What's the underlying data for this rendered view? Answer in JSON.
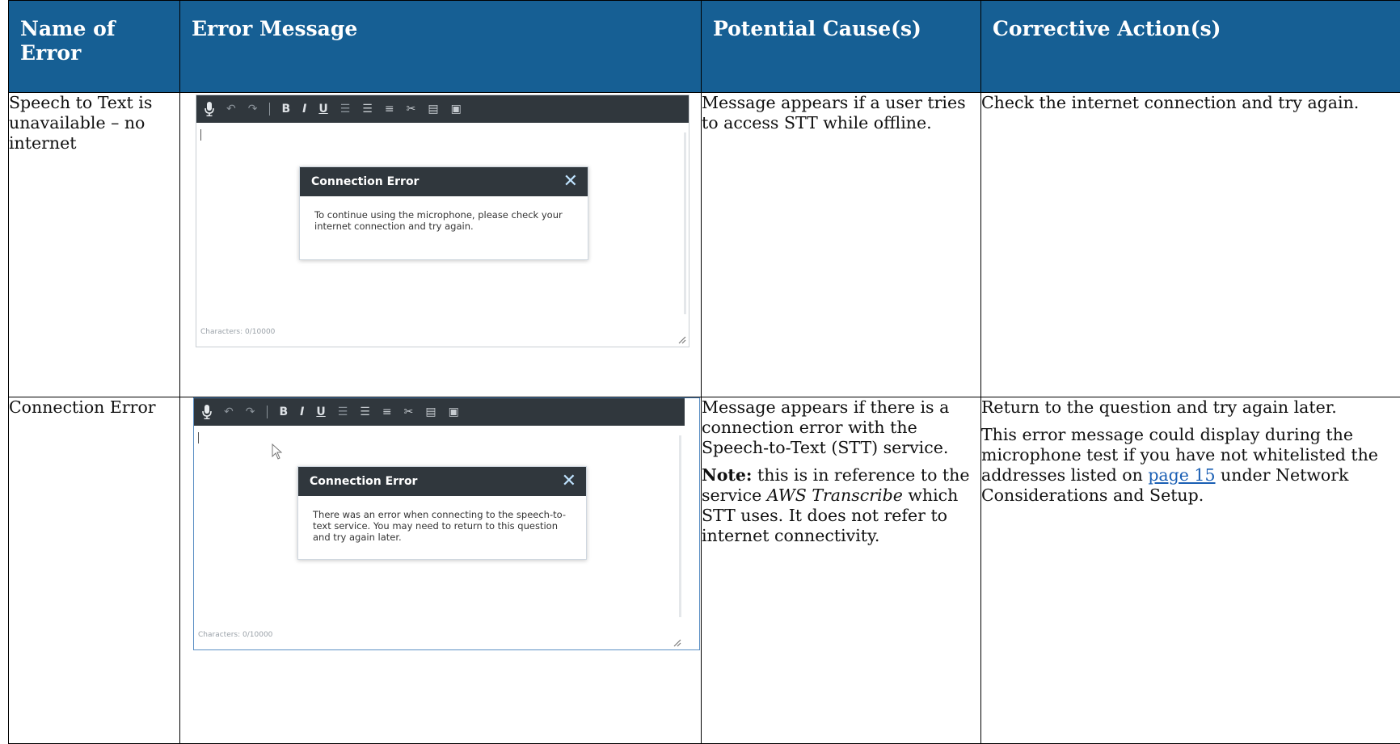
{
  "table": {
    "headers": [
      "Name of Error",
      "Error Message",
      "Potential Cause(s)",
      "Corrective Action(s)"
    ],
    "rows": [
      {
        "name": "Speech to Text is unavailable – no internet",
        "shot": {
          "dialog_title": "Connection Error",
          "dialog_body": "To continue using the microphone, please check your internet connection and try again.",
          "char_count": "Characters: 0/10000"
        },
        "causes": [
          "Message appears if a user tries to access STT while offline."
        ],
        "actions": [
          "Check the internet connection and try again."
        ]
      },
      {
        "name": "Connection Error",
        "shot": {
          "dialog_title": "Connection Error",
          "dialog_body": "There was an error when connecting to the speech-to-text service. You may need to return to this question and try again later.",
          "char_count": "Characters: 0/10000"
        },
        "causes": [
          "Message appears if there is a connection error with the Speech-to-Text (STT) service.",
          {
            "note_label": "Note:",
            "note_pre": " this is in reference to the service ",
            "note_italic": "AWS Transcribe",
            "note_post": " which STT uses. It does not refer to internet connectivity."
          }
        ],
        "actions": [
          "Return to the question and try again later.",
          {
            "pre": "This error message could display during the microphone test if you have not whitelisted the addresses listed on ",
            "link": "page 15",
            "post": " under Network Considerations and Setup."
          }
        ]
      }
    ]
  },
  "toolbar_icons": [
    "microphone-icon",
    "undo-icon",
    "redo-icon",
    "bold-icon",
    "italic-icon",
    "underline-icon",
    "outdent-icon",
    "indent-icon",
    "bulleted-list-icon",
    "cut-icon",
    "copy-icon",
    "paste-icon"
  ],
  "colors": {
    "header_bg": "#165f94",
    "toolbar_bg": "#30373d",
    "close_icon": "#bfe3ff",
    "link": "#1a5fb4"
  }
}
